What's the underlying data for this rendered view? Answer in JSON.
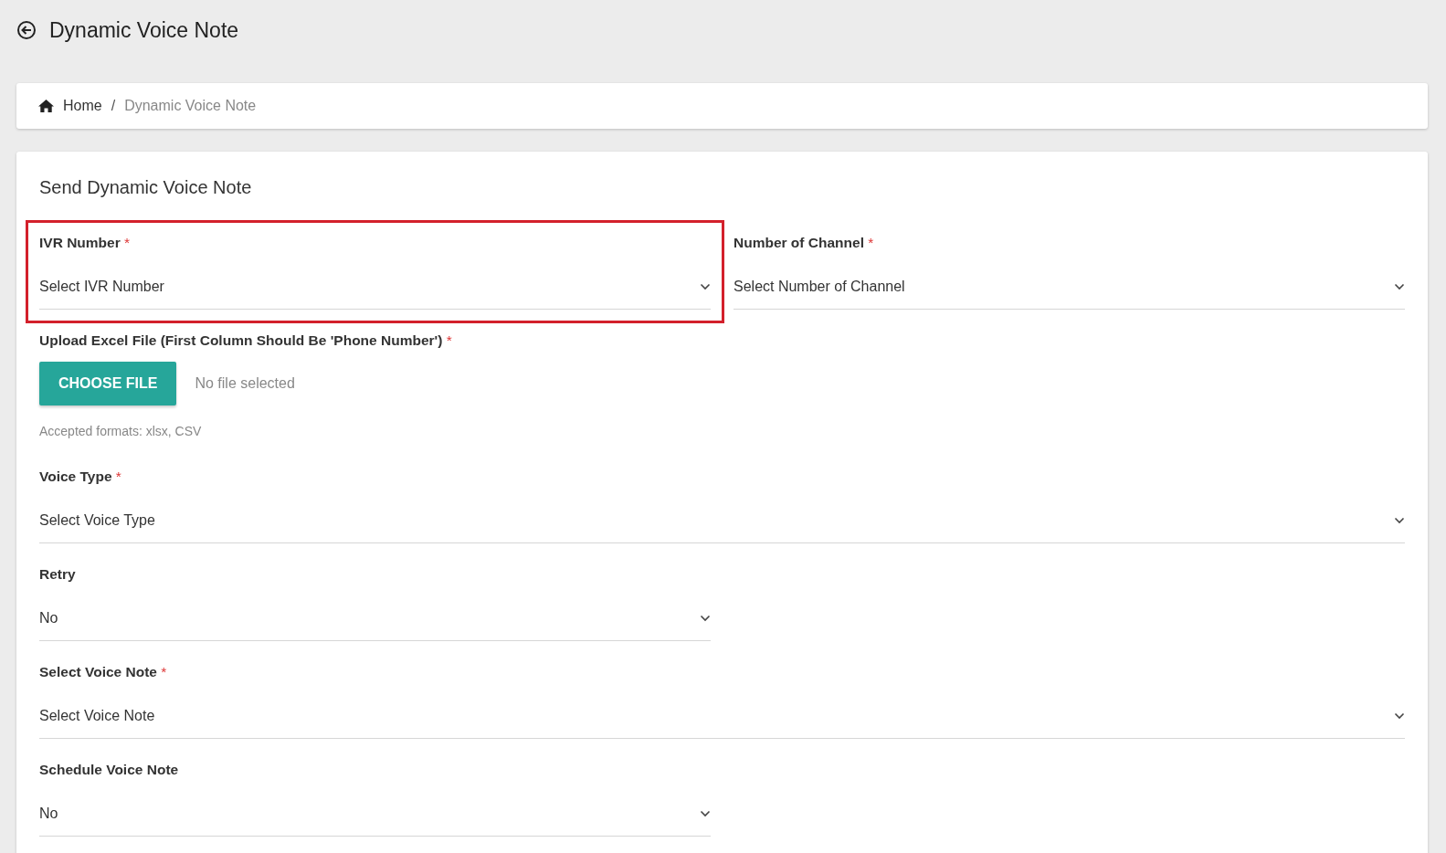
{
  "header": {
    "title": "Dynamic Voice Note"
  },
  "breadcrumb": {
    "separator": "/",
    "items": [
      {
        "label": "Home",
        "current": false
      },
      {
        "label": "Dynamic Voice Note",
        "current": true
      }
    ]
  },
  "form": {
    "title": "Send Dynamic Voice Note",
    "rows": [
      {
        "fields": [
          {
            "kind": "select",
            "label": "IVR Number",
            "required_mark": "*",
            "placeholder": "Select IVR Number",
            "highlighted": true,
            "wide": false
          },
          {
            "kind": "select",
            "label": "Number of Channel",
            "required_mark": "*",
            "placeholder": "Select Number of Channel",
            "highlighted": false,
            "wide": false
          }
        ]
      },
      {
        "fields": [
          {
            "kind": "file",
            "label": "Upload Excel File (First Column Should Be 'Phone Number')",
            "required_mark": "*",
            "button": "CHOOSE FILE",
            "status": "No file selected",
            "hint": "Accepted formats: xlsx, CSV"
          }
        ]
      },
      {
        "fields": [
          {
            "kind": "select",
            "label": "Voice Type",
            "required_mark": "*",
            "placeholder": "Select Voice Type",
            "highlighted": false,
            "wide": true
          }
        ]
      },
      {
        "fields": [
          {
            "kind": "select",
            "label": "Retry",
            "value": "No",
            "highlighted": false,
            "wide": false
          }
        ]
      },
      {
        "fields": [
          {
            "kind": "select",
            "label": "Select Voice Note",
            "required_mark": "*",
            "placeholder": "Select Voice Note",
            "highlighted": false,
            "wide": true
          }
        ]
      },
      {
        "fields": [
          {
            "kind": "select",
            "label": "Schedule Voice Note",
            "value": "No",
            "highlighted": false,
            "wide": false
          }
        ]
      }
    ]
  }
}
